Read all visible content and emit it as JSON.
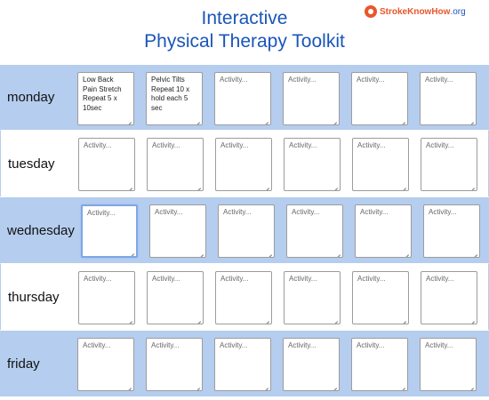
{
  "header": {
    "title_line1": "Interactive",
    "title_line2": "Physical Therapy Toolkit",
    "logo_text": "StrokeKnowHow",
    "logo_suffix": ".org"
  },
  "placeholder": "Activity...",
  "days": [
    {
      "label": "monday",
      "cells": [
        "Low Back Pain Stretch Repeat 5 x 10sec",
        "Pelvic Tilts Repeat 10 x hold each 5 sec",
        "",
        "",
        "",
        ""
      ]
    },
    {
      "label": "tuesday",
      "cells": [
        "",
        "",
        "",
        "",
        "",
        ""
      ]
    },
    {
      "label": "wednesday",
      "cells": [
        "",
        "",
        "",
        "",
        "",
        ""
      ]
    },
    {
      "label": "thursday",
      "cells": [
        "",
        "",
        "",
        "",
        "",
        ""
      ]
    },
    {
      "label": "friday",
      "cells": [
        "",
        "",
        "",
        "",
        "",
        ""
      ]
    }
  ],
  "colors": {
    "title": "#1a56b8",
    "row_band": "#b5cdee",
    "logo": "#e8562a"
  }
}
